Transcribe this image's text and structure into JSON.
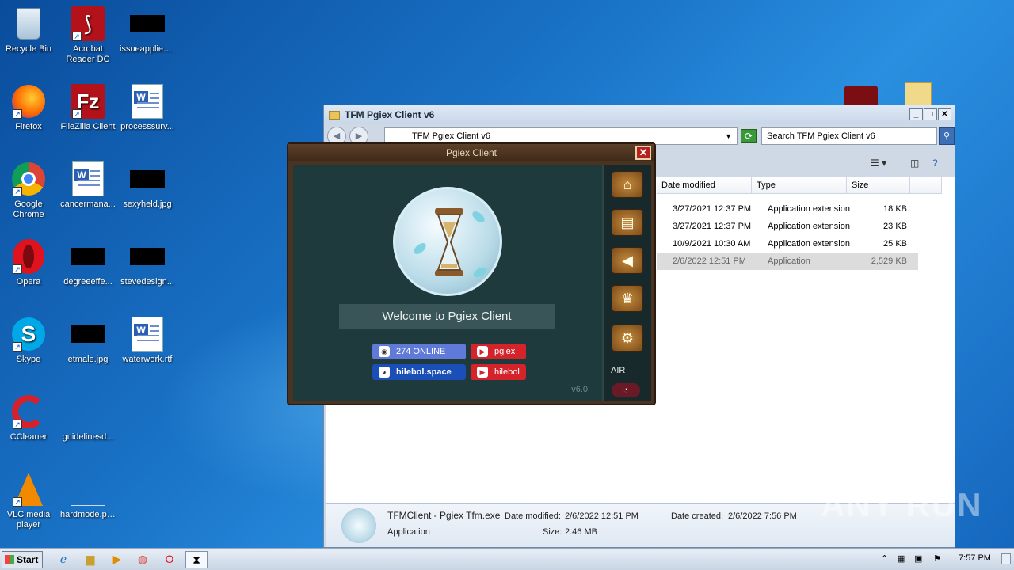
{
  "desktop": {
    "icons": [
      {
        "label": "Recycle Bin",
        "icon": "recycle-bin-icon"
      },
      {
        "label": "Acrobat Reader DC",
        "line2": "Reader DC",
        "line1": "Acrobat",
        "icon": "acrobat-icon"
      },
      {
        "label": "issueapplied...",
        "icon": "file-icon"
      },
      {
        "label": "Firefox",
        "icon": "firefox-icon"
      },
      {
        "label": "FileZilla Client",
        "icon": "filezilla-icon"
      },
      {
        "label": "processsurv...",
        "icon": "word-doc-icon"
      },
      {
        "label": "Google Chrome",
        "line1": "Google",
        "line2": "Chrome",
        "icon": "chrome-icon"
      },
      {
        "label": "cancermana...",
        "icon": "word-doc-icon"
      },
      {
        "label": "sexyheld.jpg",
        "icon": "image-file-icon"
      },
      {
        "label": "Opera",
        "icon": "opera-icon"
      },
      {
        "label": "degreeeffe...",
        "icon": "file-icon"
      },
      {
        "label": "stevedesign...",
        "icon": "file-icon"
      },
      {
        "label": "Skype",
        "icon": "skype-icon"
      },
      {
        "label": "etmale.jpg",
        "icon": "image-file-icon"
      },
      {
        "label": "waterwork.rtf",
        "icon": "word-doc-icon"
      },
      {
        "label": "CCleaner",
        "icon": "ccleaner-icon"
      },
      {
        "label": "guidelinesd...",
        "icon": "file-icon"
      },
      {
        "label": "VLC media player",
        "line1": "VLC media",
        "line2": "player",
        "icon": "vlc-icon"
      },
      {
        "label": "hardmode.png",
        "icon": "image-file-icon"
      }
    ]
  },
  "explorer": {
    "title": "TFM Pgiex Client v6",
    "address": "TFM Pgiex Client v6",
    "search_placeholder": "Search TFM Pgiex Client v6",
    "columns": [
      "Date modified",
      "Type",
      "Size"
    ],
    "rows": [
      {
        "date": "3/27/2021 12:37 PM",
        "type": "Application extension",
        "size": "18 KB"
      },
      {
        "date": "3/27/2021 12:37 PM",
        "type": "Application extension",
        "size": "23 KB"
      },
      {
        "date": "10/9/2021 10:30 AM",
        "type": "Application extension",
        "size": "25 KB"
      },
      {
        "date": "2/6/2022 12:51 PM",
        "type": "Application",
        "size": "2,529 KB"
      }
    ],
    "details": {
      "name": "TFMClient - Pgiex Tfm.exe",
      "kind": "Application",
      "modified_label": "Date modified:",
      "modified": "2/6/2022 12:51 PM",
      "size_label": "Size:",
      "size": "2.46 MB",
      "created_label": "Date created:",
      "created": "2/6/2022 7:56 PM"
    }
  },
  "pgiex": {
    "title": "Pgiex Client",
    "welcome": "Welcome to Pgiex Client",
    "discord_online": "274 ONLINE",
    "youtube1": "pgiex",
    "site": "hilebol.space",
    "youtube2": "hilebol",
    "version": "v6.0",
    "air_label": "AIR"
  },
  "taskbar": {
    "start_label": "Start",
    "clock": "7:57 PM"
  },
  "watermark": "ANY RUN"
}
